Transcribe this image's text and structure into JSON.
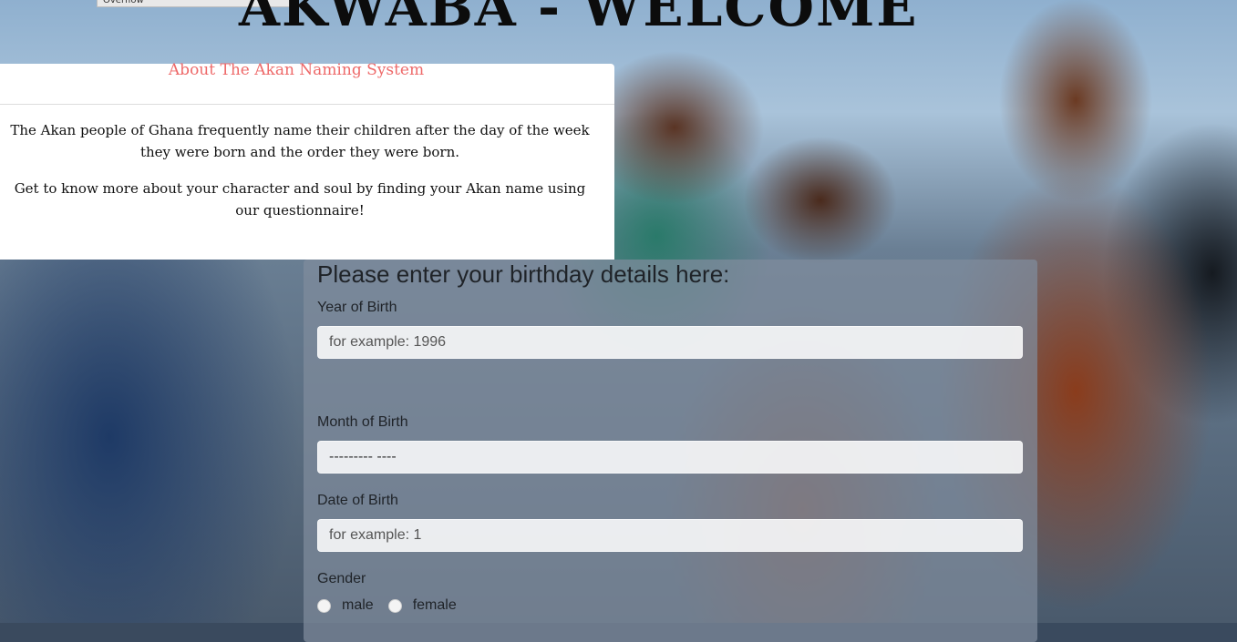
{
  "header": {
    "overlay_text": "Overflow",
    "title": "AKWABA - WELCOME"
  },
  "about": {
    "heading": "About The Akan Naming System",
    "paragraphs": [
      "The Akan people of Ghana frequently name their children after the day of the week they were born and the order they were born.",
      "Get to know more about your character and soul by finding your Akan name using our questionnaire!"
    ]
  },
  "form": {
    "heading": "Please enter your birthday details here:",
    "year": {
      "label": "Year of Birth",
      "placeholder": "for example: 1996"
    },
    "month": {
      "label": "Month of Birth",
      "selected": "--------- ----"
    },
    "date": {
      "label": "Date of Birth",
      "placeholder": "for example: 1"
    },
    "gender": {
      "label": "Gender",
      "options": [
        "male",
        "female"
      ]
    }
  },
  "colors": {
    "about_heading": "#ee6a6a",
    "panel_overlay": "rgba(128,140,156,0.72)"
  }
}
